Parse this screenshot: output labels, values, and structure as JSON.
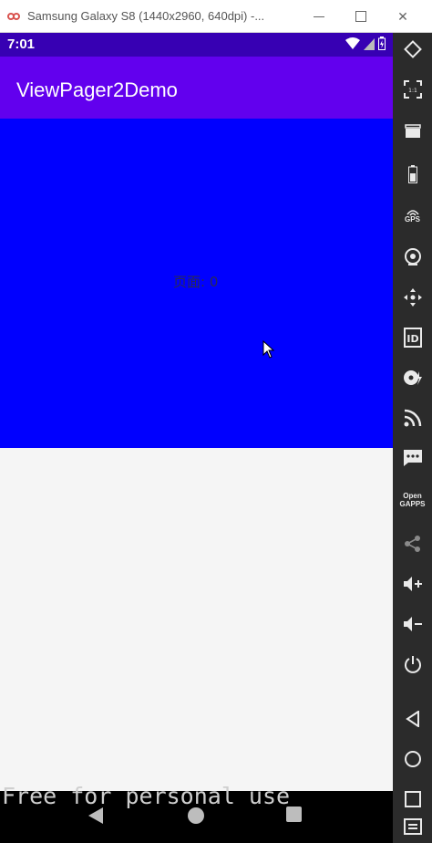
{
  "window": {
    "title": "Samsung Galaxy S8 (1440x2960, 640dpi) -...",
    "minimize_label": "",
    "maximize_label": "",
    "close_label": "✕"
  },
  "status_bar": {
    "time": "7:01"
  },
  "app_bar": {
    "title": "ViewPager2Demo"
  },
  "pager": {
    "page_label": "页面: 0",
    "current_page": 0,
    "background": "#0000ff"
  },
  "watermark": "Free for personal use",
  "toolbar": {
    "gps_label": "GPS",
    "id_label": "ID",
    "opengapps_label": "Open\nGAPPS"
  },
  "colors": {
    "status_bar": "#3700b3",
    "app_bar": "#6200ee",
    "page": "#0000ff",
    "sidebar": "#2b2b2b"
  }
}
